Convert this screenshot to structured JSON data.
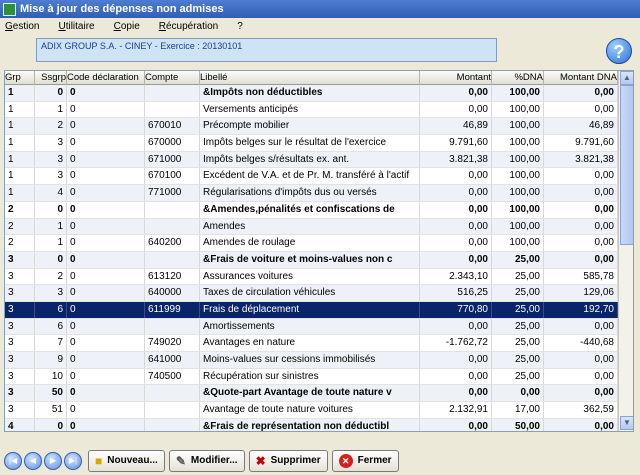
{
  "window": {
    "title": "Mise à jour  des dépenses non admises"
  },
  "menu": [
    {
      "label": "Gestion",
      "accel": "G",
      "rest": "estion"
    },
    {
      "label": "Utilitaire",
      "accel": "U",
      "rest": "tilitaire"
    },
    {
      "label": "Copie",
      "accel": "C",
      "rest": "opie"
    },
    {
      "label": "Récupération",
      "accel": "R",
      "rest": "écupération"
    },
    {
      "label": "?",
      "accel": "",
      "rest": "?"
    }
  ],
  "company": {
    "text": "ADIX GROUP S.A.  - CINEY - Exercice : 20130101"
  },
  "help": {
    "glyph": "?"
  },
  "grid": {
    "columns": [
      "Grp",
      "Ssgrp",
      "Code déclaration",
      "Compte",
      "Libellé",
      "Montant",
      "%DNA",
      "Montant DNA"
    ],
    "rows": [
      {
        "grp": "1",
        "ssgrp": "0",
        "code": "0",
        "compte": "",
        "libelle": "&Impôts non déductibles",
        "montant": "0,00",
        "dna": "100,00",
        "mdna": "0,00",
        "bold": true,
        "selected": false
      },
      {
        "grp": "1",
        "ssgrp": "1",
        "code": "0",
        "compte": "",
        "libelle": "Versements anticipés",
        "montant": "0,00",
        "dna": "100,00",
        "mdna": "0,00",
        "bold": false,
        "selected": false
      },
      {
        "grp": "1",
        "ssgrp": "2",
        "code": "0",
        "compte": "670010",
        "libelle": "Précompte mobilier",
        "montant": "46,89",
        "dna": "100,00",
        "mdna": "46,89",
        "bold": false,
        "selected": false
      },
      {
        "grp": "1",
        "ssgrp": "3",
        "code": "0",
        "compte": "670000",
        "libelle": "Impôts belges sur le résultat de l'exercice",
        "montant": "9.791,60",
        "dna": "100,00",
        "mdna": "9.791,60",
        "bold": false,
        "selected": false
      },
      {
        "grp": "1",
        "ssgrp": "3",
        "code": "0",
        "compte": "671000",
        "libelle": "Impôts belges s/résultats ex. ant.",
        "montant": "3.821,38",
        "dna": "100,00",
        "mdna": "3.821,38",
        "bold": false,
        "selected": false
      },
      {
        "grp": "1",
        "ssgrp": "3",
        "code": "0",
        "compte": "670100",
        "libelle": "Excédent de V.A. et de Pr. M. transféré à l'actif",
        "montant": "0,00",
        "dna": "100,00",
        "mdna": "0,00",
        "bold": false,
        "selected": false
      },
      {
        "grp": "1",
        "ssgrp": "4",
        "code": "0",
        "compte": "771000",
        "libelle": "Régularisations d'impôts dus ou versés",
        "montant": "0,00",
        "dna": "100,00",
        "mdna": "0,00",
        "bold": false,
        "selected": false
      },
      {
        "grp": "2",
        "ssgrp": "0",
        "code": "0",
        "compte": "",
        "libelle": "&Amendes,pénalités et confiscations de",
        "montant": "0,00",
        "dna": "100,00",
        "mdna": "0,00",
        "bold": true,
        "selected": false
      },
      {
        "grp": "2",
        "ssgrp": "1",
        "code": "0",
        "compte": "",
        "libelle": "Amendes",
        "montant": "0,00",
        "dna": "100,00",
        "mdna": "0,00",
        "bold": false,
        "selected": false
      },
      {
        "grp": "2",
        "ssgrp": "1",
        "code": "0",
        "compte": "640200",
        "libelle": "Amendes de roulage",
        "montant": "0,00",
        "dna": "100,00",
        "mdna": "0,00",
        "bold": false,
        "selected": false
      },
      {
        "grp": "3",
        "ssgrp": "0",
        "code": "0",
        "compte": "",
        "libelle": "&Frais de voiture et moins-values non c",
        "montant": "0,00",
        "dna": "25,00",
        "mdna": "0,00",
        "bold": true,
        "selected": false
      },
      {
        "grp": "3",
        "ssgrp": "2",
        "code": "0",
        "compte": "613120",
        "libelle": "Assurances voitures",
        "montant": "2.343,10",
        "dna": "25,00",
        "mdna": "585,78",
        "bold": false,
        "selected": false
      },
      {
        "grp": "3",
        "ssgrp": "3",
        "code": "0",
        "compte": "640000",
        "libelle": "Taxes de circulation véhicules",
        "montant": "516,25",
        "dna": "25,00",
        "mdna": "129,06",
        "bold": false,
        "selected": false
      },
      {
        "grp": "3",
        "ssgrp": "6",
        "code": "0",
        "compte": "611999",
        "libelle": "Frais de déplacement",
        "montant": "770,80",
        "dna": "25,00",
        "mdna": "192,70",
        "bold": false,
        "selected": true
      },
      {
        "grp": "3",
        "ssgrp": "6",
        "code": "0",
        "compte": "",
        "libelle": "Amortissements",
        "montant": "0,00",
        "dna": "25,00",
        "mdna": "0,00",
        "bold": false,
        "selected": false
      },
      {
        "grp": "3",
        "ssgrp": "7",
        "code": "0",
        "compte": "749020",
        "libelle": "Avantages en nature",
        "montant": "-1.762,72",
        "dna": "25,00",
        "mdna": "-440,68",
        "bold": false,
        "selected": false
      },
      {
        "grp": "3",
        "ssgrp": "9",
        "code": "0",
        "compte": "641000",
        "libelle": "Moins-values sur cessions immobilisés",
        "montant": "0,00",
        "dna": "25,00",
        "mdna": "0,00",
        "bold": false,
        "selected": false
      },
      {
        "grp": "3",
        "ssgrp": "10",
        "code": "0",
        "compte": "740500",
        "libelle": "Récupération sur sinistres",
        "montant": "0,00",
        "dna": "25,00",
        "mdna": "0,00",
        "bold": false,
        "selected": false
      },
      {
        "grp": "3",
        "ssgrp": "50",
        "code": "0",
        "compte": "",
        "libelle": "&Quote-part Avantage de toute nature v",
        "montant": "0,00",
        "dna": "0,00",
        "mdna": "0,00",
        "bold": true,
        "selected": false
      },
      {
        "grp": "3",
        "ssgrp": "51",
        "code": "0",
        "compte": "",
        "libelle": "Avantage de toute nature voitures",
        "montant": "2.132,91",
        "dna": "17,00",
        "mdna": "362,59",
        "bold": false,
        "selected": false
      },
      {
        "grp": "4",
        "ssgrp": "0",
        "code": "0",
        "compte": "",
        "libelle": "&Frais de représentation non déductibl",
        "montant": "0,00",
        "dna": "50,00",
        "mdna": "0,00",
        "bold": true,
        "selected": false
      }
    ]
  },
  "toolbar": {
    "new_label": "Nouveau...",
    "edit_label": "Modifier...",
    "delete_label": "Supprimer",
    "close_label": "Fermer"
  }
}
